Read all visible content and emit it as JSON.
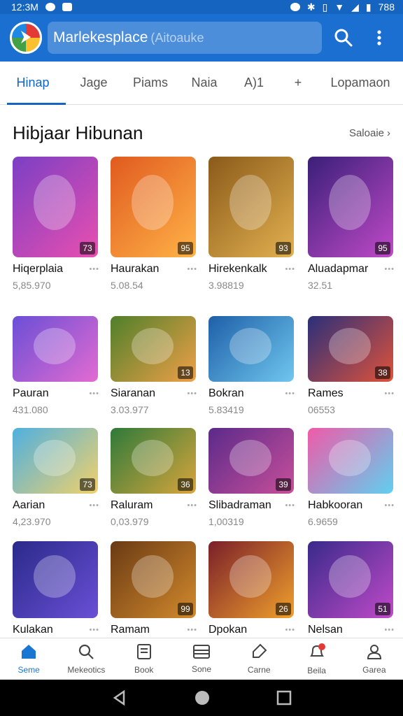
{
  "status_bar": {
    "time": "12:3M",
    "battery": "788"
  },
  "app_bar": {
    "title": "Marlekesplace",
    "placeholder": "(Aitoauke"
  },
  "tabs": [
    {
      "label": "Hinap",
      "active": true
    },
    {
      "label": "Jage"
    },
    {
      "label": "Piams"
    },
    {
      "label": "Naia"
    },
    {
      "label": "A)1"
    },
    {
      "label": "+"
    },
    {
      "label": "Lopamaon"
    }
  ],
  "section": {
    "title": "Hibjaar Hibunan",
    "see_all": "Saloaie"
  },
  "cards": [
    {
      "name": "Hiqerplaia",
      "count": "5,85.970",
      "badge": "73",
      "colors": [
        "#7b3fc4",
        "#e94fb0"
      ]
    },
    {
      "name": "Haurakan",
      "count": "5.08.54",
      "badge": "95",
      "colors": [
        "#e05a1f",
        "#ffb347"
      ]
    },
    {
      "name": "Hirekenkalk",
      "count": "3.98819",
      "badge": "93",
      "colors": [
        "#8a5a1a",
        "#e3b150"
      ]
    },
    {
      "name": "Aluadapmar",
      "count": "32.51",
      "badge": "95",
      "colors": [
        "#3a1f78",
        "#c04ac8"
      ]
    },
    {
      "name": "Pauran",
      "count": "431.080",
      "badge": "",
      "colors": [
        "#6a4fd6",
        "#e36bd1"
      ]
    },
    {
      "name": "Siaranan",
      "count": "3.03.977",
      "badge": "13",
      "colors": [
        "#4f7f2a",
        "#f0a048"
      ]
    },
    {
      "name": "Bokran",
      "count": "5.83419",
      "badge": "",
      "colors": [
        "#1e5fa8",
        "#6fc7ee"
      ]
    },
    {
      "name": "Rames",
      "count": "06553",
      "badge": "38",
      "colors": [
        "#2a2f7a",
        "#e0523a"
      ]
    },
    {
      "name": "Aarian",
      "count": "4,23.970",
      "badge": "73",
      "colors": [
        "#4fb0e0",
        "#f2d16a"
      ]
    },
    {
      "name": "Raluram",
      "count": "0,03.979",
      "badge": "36",
      "colors": [
        "#2e7a3a",
        "#d9a53c"
      ]
    },
    {
      "name": "Slibadraman",
      "count": "1,00319",
      "badge": "39",
      "colors": [
        "#5b2a8a",
        "#c84f9a"
      ]
    },
    {
      "name": "Habkooran",
      "count": "6.9659",
      "badge": "",
      "colors": [
        "#f05aa8",
        "#5fd0f0"
      ]
    },
    {
      "name": "Kulakan",
      "count": "",
      "badge": "",
      "colors": [
        "#2a2a8a",
        "#6a4fd6"
      ]
    },
    {
      "name": "Ramam",
      "count": "",
      "badge": "99",
      "colors": [
        "#6a3a14",
        "#d28a2c"
      ]
    },
    {
      "name": "Dpokan",
      "count": "",
      "badge": "26",
      "colors": [
        "#7a1f2a",
        "#f0a02c"
      ]
    },
    {
      "name": "Nelsan",
      "count": "",
      "badge": "51",
      "colors": [
        "#3a2a8a",
        "#c04ac8"
      ]
    }
  ],
  "bottom_nav": [
    {
      "label": "Seme",
      "icon": "home-icon",
      "active": true
    },
    {
      "label": "Mekeotics",
      "icon": "search-icon"
    },
    {
      "label": "Book",
      "icon": "book-icon"
    },
    {
      "label": "Sone",
      "icon": "list-icon"
    },
    {
      "label": "Carne",
      "icon": "tag-icon"
    },
    {
      "label": "Beila",
      "icon": "bell-icon"
    },
    {
      "label": "Garea",
      "icon": "person-icon"
    }
  ],
  "colors": {
    "primary": "#1a6fd0",
    "status_bar": "#1565c0",
    "active_tab": "#1565c0"
  }
}
